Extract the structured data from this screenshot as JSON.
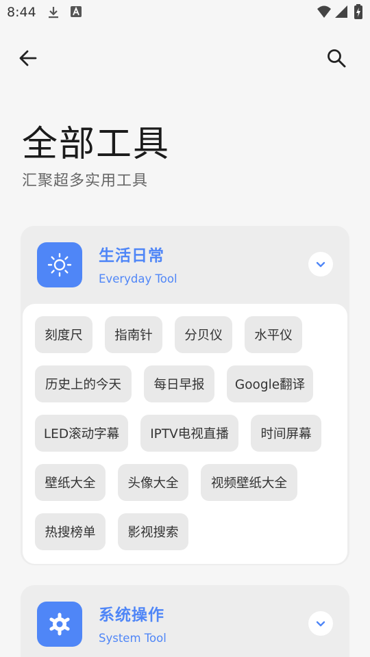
{
  "status": {
    "time": "8:44"
  },
  "header": {
    "title": "全部工具",
    "subtitle": "汇聚超多实用工具"
  },
  "categories": [
    {
      "title": "生活日常",
      "subtitle": "Everyday Tool",
      "icon": "sun-icon",
      "tools": [
        "刻度尺",
        "指南针",
        "分贝仪",
        "水平仪",
        "历史上的今天",
        "每日早报",
        "Google翻译",
        "LED滚动字幕",
        "IPTV电视直播",
        "时间屏幕",
        "壁纸大全",
        "头像大全",
        "视频壁纸大全",
        "热搜榜单",
        "影视搜索"
      ]
    },
    {
      "title": "系统操作",
      "subtitle": "System Tool",
      "icon": "gear-icon"
    }
  ],
  "colors": {
    "accent": "#4f86f7",
    "card_bg": "#ededed",
    "chip_bg": "#e9e9e9",
    "page_bg": "#f6f6f6"
  }
}
